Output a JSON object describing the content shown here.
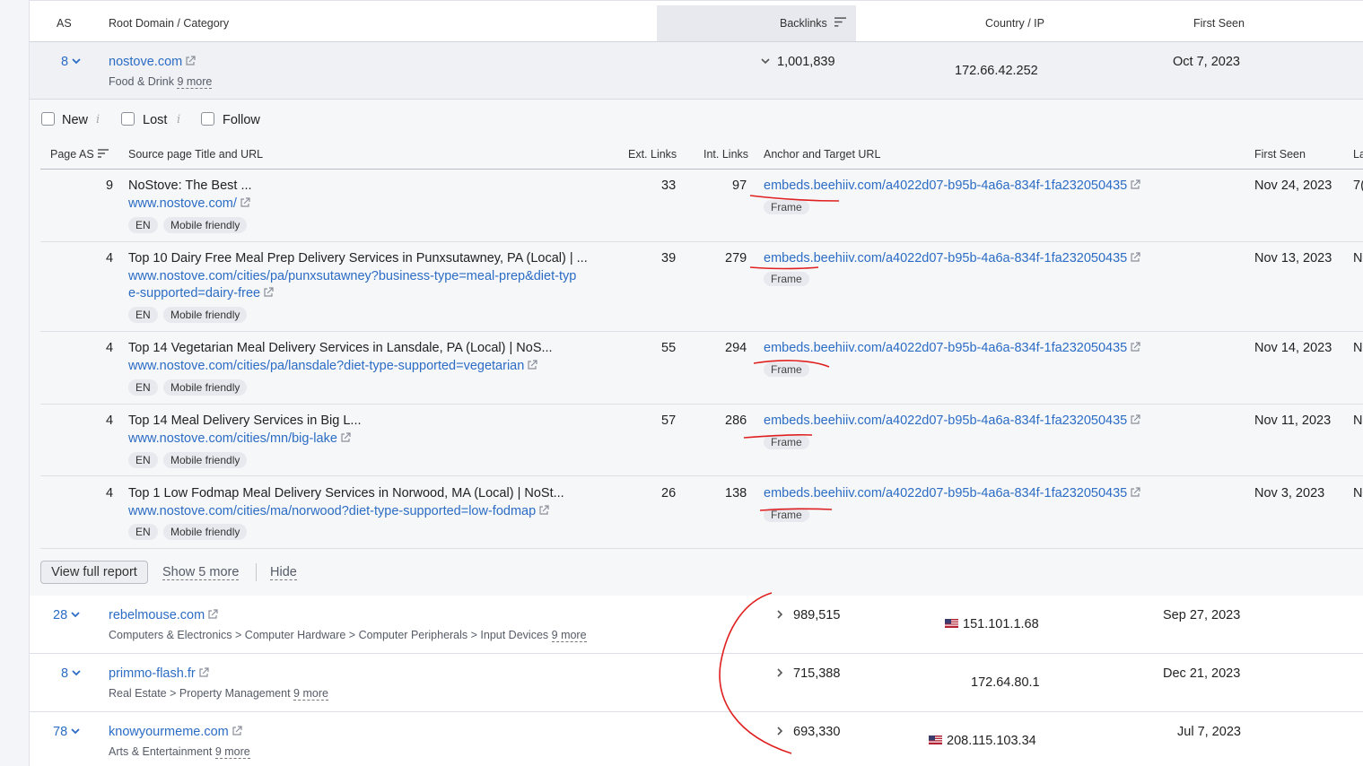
{
  "header": {
    "as": "AS",
    "root_domain": "Root Domain / Category",
    "backlinks": "Backlinks",
    "country_ip": "Country / IP",
    "first_seen": "First Seen"
  },
  "expanded_domain": {
    "as": "8",
    "domain": "nostove.com",
    "category": "Food & Drink",
    "more": "9 more",
    "backlinks": "1,001,839",
    "ip": "172.66.42.252",
    "first_seen": "Oct 7, 2023"
  },
  "filters": [
    {
      "label": "New",
      "checked": false
    },
    {
      "label": "Lost",
      "checked": false
    },
    {
      "label": "Follow",
      "checked": false
    }
  ],
  "sub_header": {
    "page_as": "Page AS",
    "source": "Source page Title and URL",
    "ext_links": "Ext. Links",
    "int_links": "Int. Links",
    "anchor": "Anchor and Target URL",
    "first_seen": "First Seen",
    "last_partial": "La"
  },
  "backlink_rows": [
    {
      "page_as": "9",
      "title": "NoStove: The Best ...",
      "url_lines": [
        "www.nostove.com/"
      ],
      "tags": [
        "EN",
        "Mobile friendly"
      ],
      "ext_links": "33",
      "int_links": "97",
      "anchor_url": "embeds.beehiiv.com/a4022d07-b95b-4a6a-834f-1fa232050435",
      "anchor_tag": "Frame",
      "first_seen": "Nov 24, 2023",
      "last_partial": "7("
    },
    {
      "page_as": "4",
      "title": "Top 10 Dairy Free Meal Prep Delivery Services in Punxsutawney, PA (Local) | ...",
      "url_lines": [
        "www.nostove.com/cities/pa/punxsutawney?business-type=meal-prep&diet-typ",
        "e-supported=dairy-free"
      ],
      "tags": [
        "EN",
        "Mobile friendly"
      ],
      "ext_links": "39",
      "int_links": "279",
      "anchor_url": "embeds.beehiiv.com/a4022d07-b95b-4a6a-834f-1fa232050435",
      "anchor_tag": "Frame",
      "first_seen": "Nov 13, 2023",
      "last_partial": "N"
    },
    {
      "page_as": "4",
      "title": "Top 14 Vegetarian Meal Delivery Services in Lansdale, PA (Local) | NoS...",
      "url_lines": [
        "www.nostove.com/cities/pa/lansdale?diet-type-supported=vegetarian"
      ],
      "tags": [
        "EN",
        "Mobile friendly"
      ],
      "ext_links": "55",
      "int_links": "294",
      "anchor_url": "embeds.beehiiv.com/a4022d07-b95b-4a6a-834f-1fa232050435",
      "anchor_tag": "Frame",
      "first_seen": "Nov 14, 2023",
      "last_partial": "N"
    },
    {
      "page_as": "4",
      "title": "Top 14 Meal Delivery Services in Big L...",
      "url_lines": [
        "www.nostove.com/cities/mn/big-lake"
      ],
      "tags": [
        "EN",
        "Mobile friendly"
      ],
      "ext_links": "57",
      "int_links": "286",
      "anchor_url": "embeds.beehiiv.com/a4022d07-b95b-4a6a-834f-1fa232050435",
      "anchor_tag": "Frame",
      "first_seen": "Nov 11, 2023",
      "last_partial": "N"
    },
    {
      "page_as": "4",
      "title": "Top 1 Low Fodmap Meal Delivery Services in Norwood, MA (Local) | NoSt...",
      "url_lines": [
        "www.nostove.com/cities/ma/norwood?diet-type-supported=low-fodmap"
      ],
      "tags": [
        "EN",
        "Mobile friendly"
      ],
      "ext_links": "26",
      "int_links": "138",
      "anchor_url": "embeds.beehiiv.com/a4022d07-b95b-4a6a-834f-1fa232050435",
      "anchor_tag": "Frame",
      "first_seen": "Nov 3, 2023",
      "last_partial": "N"
    }
  ],
  "panel_actions": {
    "view_full": "View full report",
    "show_more": "Show 5 more",
    "hide": "Hide"
  },
  "domain_rows": [
    {
      "as": "28",
      "domain": "rebelmouse.com",
      "category": "Computers & Electronics > Computer Hardware > Computer Peripherals > Input Devices",
      "more": "9 more",
      "backlinks": "989,515",
      "flag": "us-flag-icon",
      "ip": "151.101.1.68",
      "first_seen": "Sep 27, 2023"
    },
    {
      "as": "8",
      "domain": "primmo-flash.fr",
      "category": "Real Estate > Property Management",
      "more": "9 more",
      "backlinks": "715,388",
      "flag": "",
      "ip": "172.64.80.1",
      "first_seen": "Dec 21, 2023"
    },
    {
      "as": "78",
      "domain": "knowyourmeme.com",
      "category": "Arts & Entertainment",
      "more": "9 more",
      "backlinks": "693,330",
      "flag": "us-flag-icon",
      "ip": "208.115.103.34",
      "first_seen": "Jul 7, 2023"
    }
  ],
  "colors": {
    "link": "#2b6cc4",
    "annotation": "#e02020"
  }
}
